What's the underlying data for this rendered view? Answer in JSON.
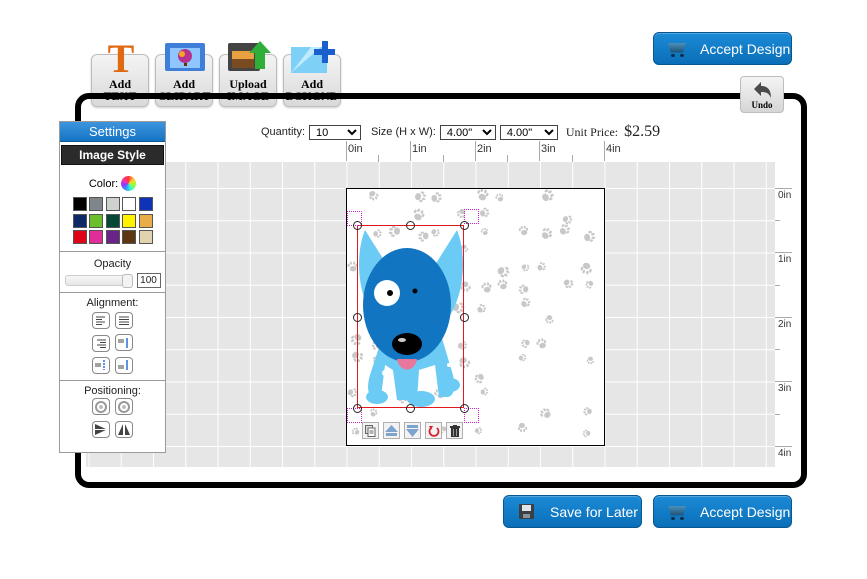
{
  "toolbar": {
    "tools": [
      {
        "line1": "Add",
        "line2": "TEXT",
        "icon": "text-t-icon"
      },
      {
        "line1": "Add",
        "line2": "CLIPART",
        "icon": "clipart-folder-icon"
      },
      {
        "line1": "Upload",
        "line2": "IMAGE",
        "icon": "upload-image-icon"
      },
      {
        "line1": "Add",
        "line2": "BCKGND",
        "icon": "add-background-icon"
      }
    ],
    "undo_label": "Undo"
  },
  "actions": {
    "accept_design": "Accept Design",
    "save_for_later": "Save for Later"
  },
  "order": {
    "quantity_label": "Quantity:",
    "quantity_value": "10",
    "size_label": "Size (H x W):",
    "height_value": "4.00\"",
    "width_value": "4.00\"",
    "unit_price_label": "Unit Price:",
    "unit_price": "$2.59"
  },
  "rulers": {
    "horizontal": [
      "0in",
      "1in",
      "2in",
      "3in",
      "4in"
    ],
    "vertical": [
      "0in",
      "1in",
      "2in",
      "3in",
      "4in"
    ]
  },
  "settings": {
    "title": "Settings",
    "tab": "Image Style",
    "color_label": "Color:",
    "swatches": [
      "#000000",
      "#7f868c",
      "#cfd0d0",
      "#ffffff",
      "#0f33b8",
      "#0e2a66",
      "#6abf2b",
      "#054834",
      "#fff300",
      "#e8ad48",
      "#df0519",
      "#e02d97",
      "#6a2386",
      "#5e3611",
      "#e0d3ae"
    ],
    "opacity_label": "Opacity",
    "opacity_value": "100",
    "alignment_label": "Alignment:",
    "positioning_label": "Positioning:"
  }
}
